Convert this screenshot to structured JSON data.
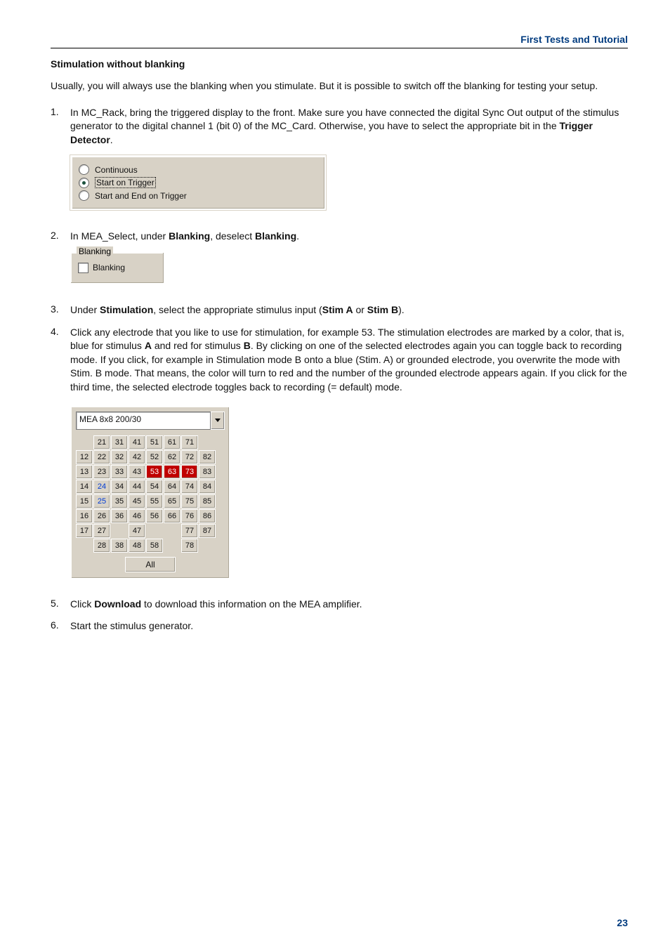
{
  "header": {
    "title": "First Tests and Tutorial"
  },
  "section": {
    "title": "Stimulation without blanking"
  },
  "intro": {
    "p1": "Usually, you will always use the blanking when you stimulate. But it is possible to switch off the blanking for testing your setup."
  },
  "steps": {
    "s1_a": "In MC_Rack, bring the triggered display to the front. Make sure you have connected the digital Sync Out output of the stimulus generator to the digital channel 1 (bit 0) of the MC_Card. Otherwise, you have to select the appropriate bit in the ",
    "s1_b": "Trigger Detector",
    "s1_c": ".",
    "s2_a": "In MEA_Select, under ",
    "s2_b": "Blanking",
    "s2_c": ", deselect ",
    "s2_d": "Blanking",
    "s2_e": ".",
    "s3_a": "Under ",
    "s3_b": "Stimulation",
    "s3_c": ", select the appropriate stimulus input (",
    "s3_d": "Stim A",
    "s3_e": " or ",
    "s3_f": "Stim B",
    "s3_g": ").",
    "s4_a": "Click any electrode that you like to use for stimulation, for example 53. The stimulation electrodes are marked by a color, that is, blue for stimulus ",
    "s4_b": "A",
    "s4_c": " and red for stimulus ",
    "s4_d": "B",
    "s4_e": ". By clicking on one of the selected electrodes again you can toggle back to recording mode. If you click, for example in Stimulation mode B onto a blue (Stim. A) or grounded electrode, you overwrite the mode with Stim. B mode. That means, the color will turn to red and the number of the grounded electrode appears again. If you click for the third time, the selected electrode toggles back to recording (= default) mode.",
    "s5_a": "Click ",
    "s5_b": "Download",
    "s5_c": " to download this information on the MEA amplifier.",
    "s6": "Start the stimulus generator."
  },
  "trigger": {
    "opt1": "Continuous",
    "opt2": "Start on Trigger",
    "opt3": "Start and End on Trigger"
  },
  "blanking": {
    "legend": "Blanking",
    "label": "Blanking"
  },
  "electrodes": {
    "dropdown": "MEA 8x8 200/30",
    "all": "All",
    "grid": [
      [
        "",
        "21",
        "31",
        "41",
        "51",
        "61",
        "71",
        ""
      ],
      [
        "12",
        "22",
        "32",
        "42",
        "52",
        "62",
        "72",
        "82"
      ],
      [
        "13",
        "23",
        "33",
        "43",
        "53",
        "63",
        "73",
        "83"
      ],
      [
        "14",
        "24",
        "34",
        "44",
        "54",
        "64",
        "74",
        "84"
      ],
      [
        "15",
        "25",
        "35",
        "45",
        "55",
        "65",
        "75",
        "85"
      ],
      [
        "16",
        "26",
        "36",
        "46",
        "56",
        "66",
        "76",
        "86"
      ],
      [
        "17",
        "27",
        "",
        "47",
        "",
        "",
        "77",
        "87"
      ],
      [
        "",
        "28",
        "38",
        "48",
        "58",
        "",
        "78",
        ""
      ]
    ],
    "blue": [
      "24",
      "25"
    ],
    "red": [
      "53",
      "63",
      "73"
    ]
  },
  "footer": {
    "page": "23"
  }
}
